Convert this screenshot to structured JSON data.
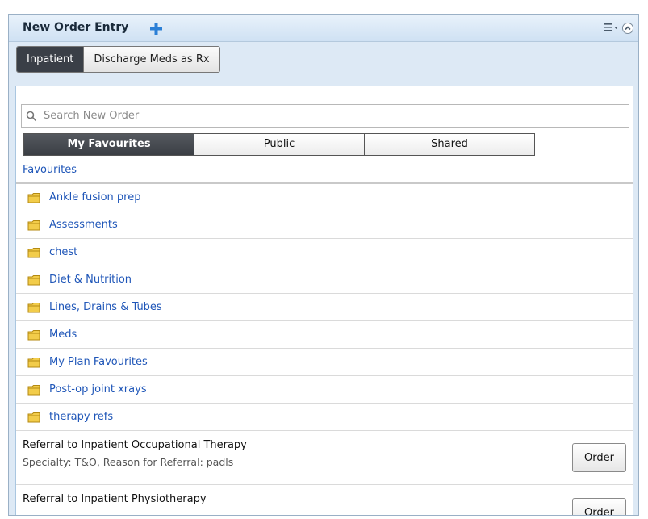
{
  "header": {
    "title": "New Order Entry",
    "add_icon": "plus-icon",
    "menu_icon": "hamburger-menu-icon",
    "collapse_icon": "chevron-up-circle-icon",
    "accent_color": "#2b7fd6"
  },
  "tabs": [
    {
      "label": "Inpatient",
      "active": true
    },
    {
      "label": "Discharge Meds as Rx",
      "active": false
    }
  ],
  "search": {
    "placeholder": "Search New Order",
    "value": ""
  },
  "segments": [
    {
      "label": "My Favourites",
      "active": true
    },
    {
      "label": "Public",
      "active": false
    },
    {
      "label": "Shared",
      "active": false
    }
  ],
  "breadcrumb": "Favourites",
  "folders": [
    {
      "label": "Ankle fusion prep"
    },
    {
      "label": "Assessments"
    },
    {
      "label": "chest"
    },
    {
      "label": "Diet & Nutrition"
    },
    {
      "label": "Lines, Drains & Tubes"
    },
    {
      "label": "Meds"
    },
    {
      "label": "My Plan Favourites"
    },
    {
      "label": "Post-op joint xrays"
    },
    {
      "label": "therapy refs"
    }
  ],
  "orders": [
    {
      "title": "Referral to Inpatient Occupational Therapy",
      "detail": "Specialty: T&O, Reason for Referral: padls",
      "button_label": "Order"
    },
    {
      "title": "Referral to Inpatient Physiotherapy",
      "detail": "",
      "button_label": "Order"
    }
  ]
}
